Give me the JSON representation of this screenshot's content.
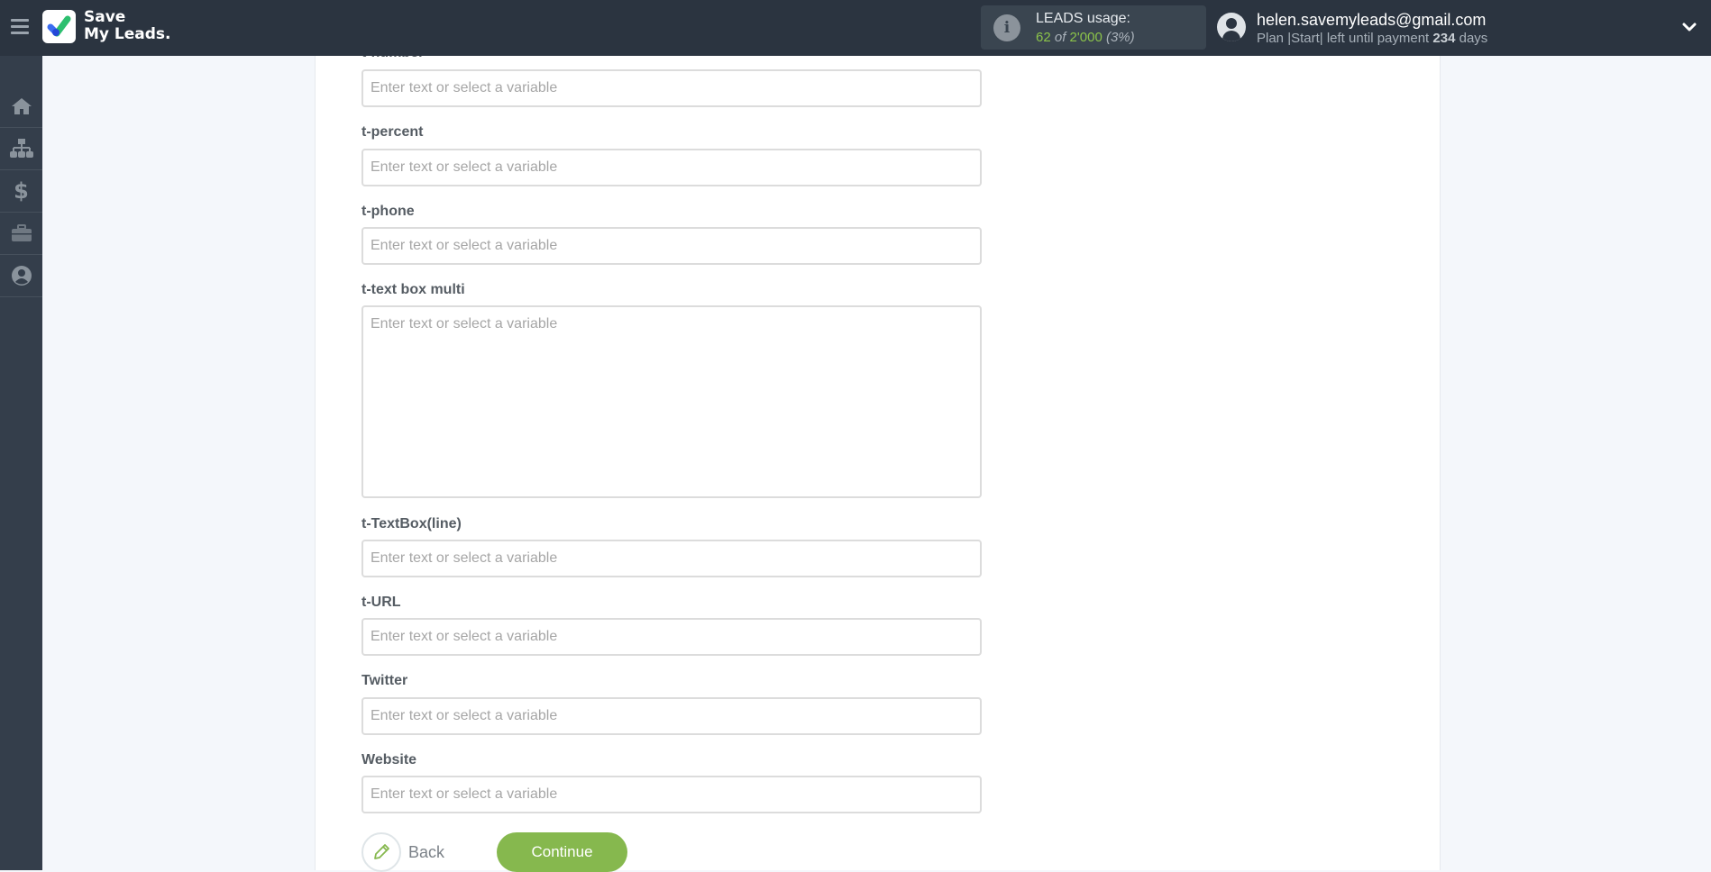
{
  "header": {
    "logo_line1": "Save",
    "logo_line2": "My Leads.",
    "usage_label": "LEADS usage:",
    "usage_used": "62",
    "usage_of": "of",
    "usage_total": "2'000",
    "usage_pct": "(3%)",
    "email": "helen.savemyleads@gmail.com",
    "plan_prefix": "Plan |Start| left until payment",
    "plan_days": "234",
    "plan_suffix": "days"
  },
  "sidebar": {
    "items": [
      {
        "name": "home",
        "icon": "home-icon"
      },
      {
        "name": "connections",
        "icon": "sitemap-icon"
      },
      {
        "name": "billing",
        "icon": "dollar-icon"
      },
      {
        "name": "tools",
        "icon": "briefcase-icon"
      },
      {
        "name": "profile",
        "icon": "user-circle-icon"
      }
    ]
  },
  "form": {
    "placeholder": "Enter text or select a variable",
    "fields": [
      {
        "label": "t-number"
      },
      {
        "label": "t-percent"
      },
      {
        "label": "t-phone"
      },
      {
        "label": "t-text box multi"
      },
      {
        "label": "t-TextBox(line)"
      },
      {
        "label": "t-URL"
      },
      {
        "label": "Twitter"
      },
      {
        "label": "Website"
      }
    ],
    "back_label": "Back",
    "continue_label": "Continue"
  },
  "colors": {
    "header_bg": "#2b3440",
    "sidebar_bg": "#343e4b",
    "accent_green": "#86b84e",
    "usage_green": "#8bc34a"
  }
}
